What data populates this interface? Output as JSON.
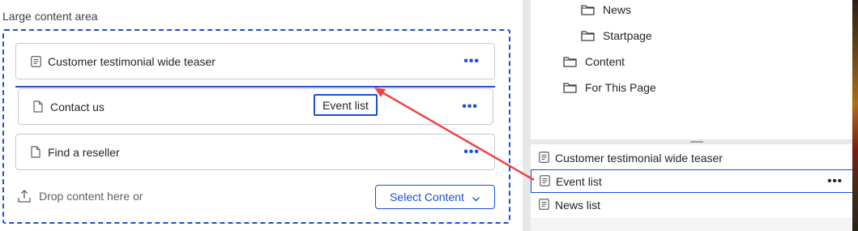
{
  "content_area": {
    "title": "Large content area",
    "blocks": [
      {
        "label": "Customer testimonial wide teaser",
        "icon": "block-icon"
      },
      {
        "label": "Contact us",
        "icon": "page-icon"
      },
      {
        "label": "Find a reseller",
        "icon": "page-icon"
      }
    ],
    "more_glyph": "•••",
    "drag_chip_label": "Event list",
    "drop_hint": "Drop content here or",
    "select_button": "Select Content"
  },
  "tree": {
    "items": [
      {
        "label": "News"
      },
      {
        "label": "Startpage"
      },
      {
        "label": "Content"
      },
      {
        "label": "For This Page"
      }
    ]
  },
  "asset_list": {
    "items": [
      {
        "label": "Customer testimonial wide teaser"
      },
      {
        "label": "Event list",
        "selected": true
      },
      {
        "label": "News list"
      }
    ],
    "more_glyph": "•••"
  },
  "colors": {
    "accent": "#1d4ed8",
    "arrow": "#ef4444"
  }
}
